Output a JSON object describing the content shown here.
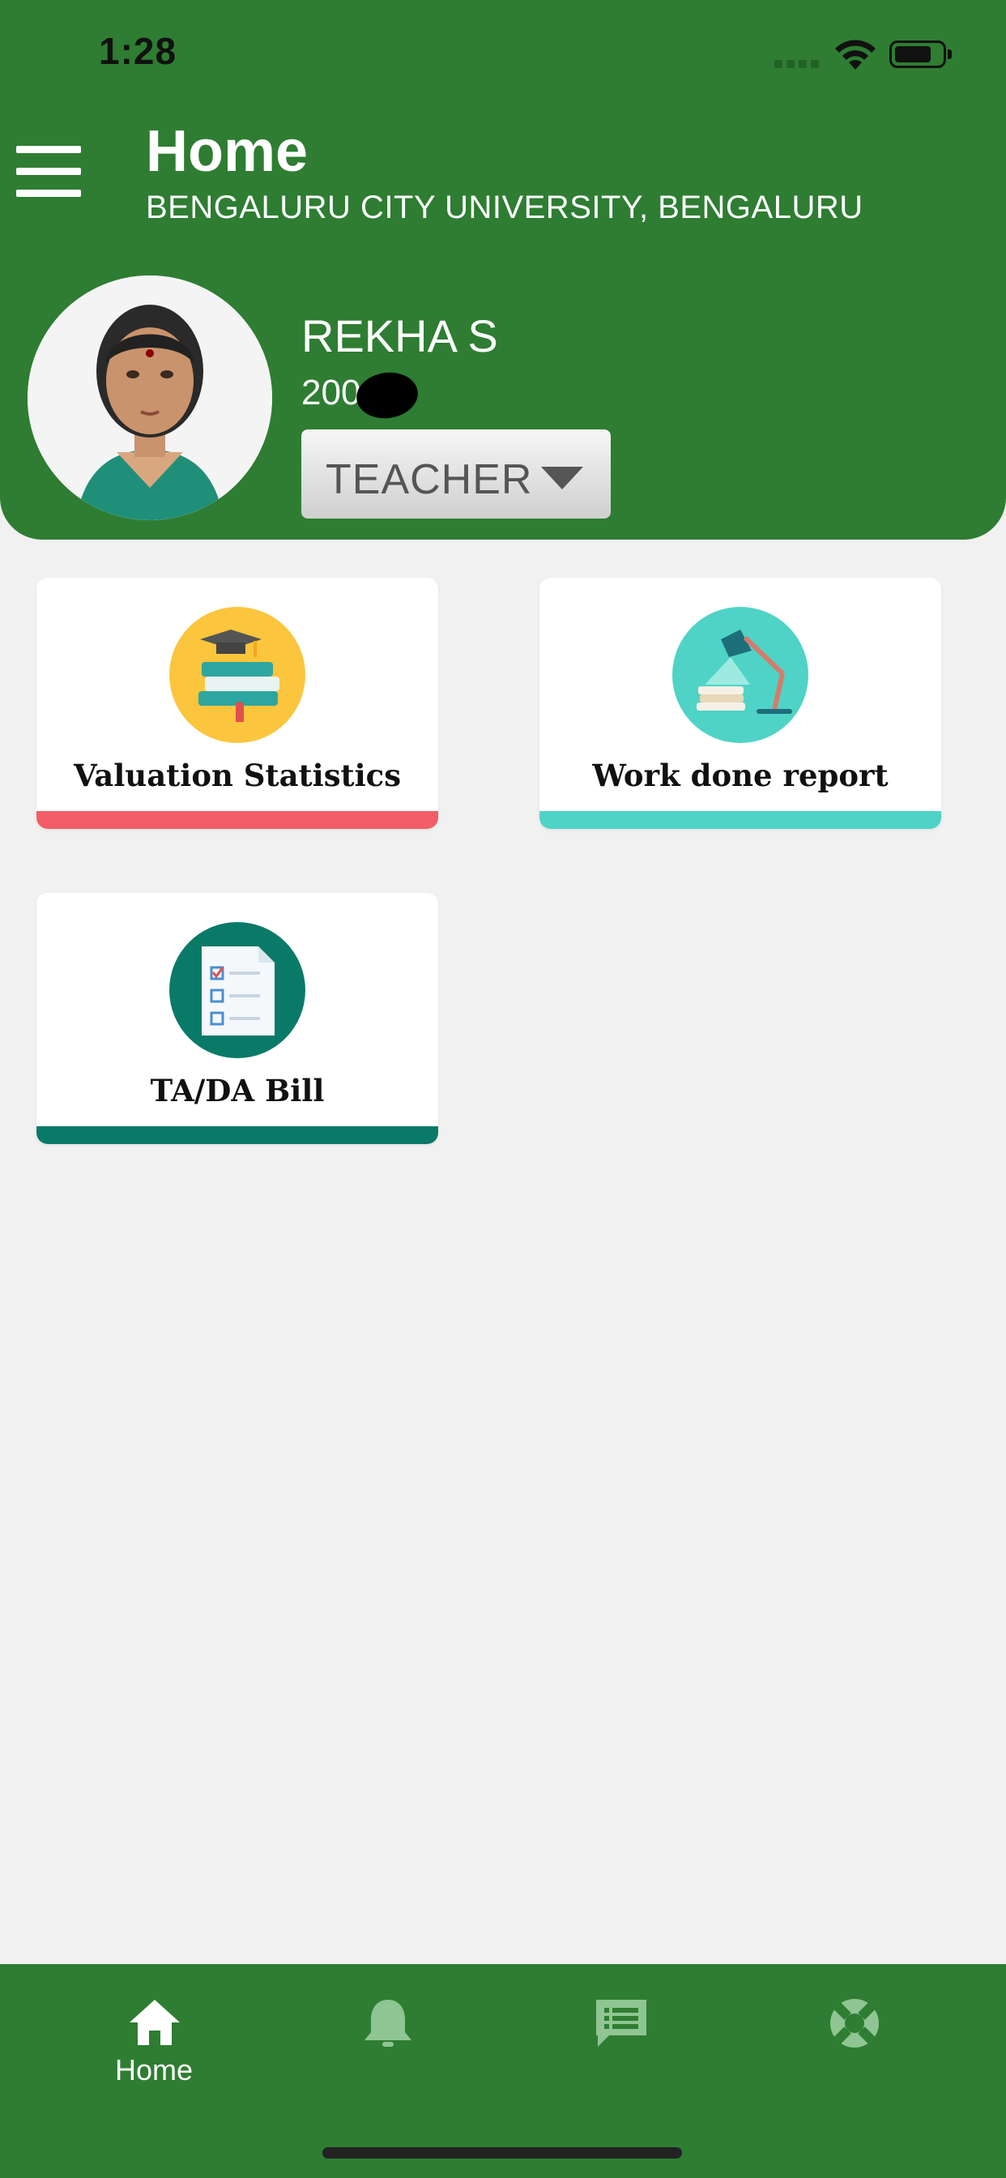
{
  "status_bar": {
    "time": "1:28"
  },
  "header": {
    "title": "Home",
    "subtitle": "BENGALURU CITY UNIVERSITY, BENGALURU"
  },
  "user": {
    "name": "REKHA S",
    "id_visible": "200",
    "role": "TEACHER"
  },
  "cards": [
    {
      "label": "Valuation Statistics",
      "accent": "#f25d67",
      "icon": "graduation-books-icon"
    },
    {
      "label": "Work done report",
      "accent": "#4fd3c6",
      "icon": "desk-lamp-icon"
    },
    {
      "label": "TA/DA Bill",
      "accent": "#0a7a68",
      "icon": "checklist-document-icon"
    }
  ],
  "bottom_nav": [
    {
      "label": "Home",
      "icon": "home-icon",
      "active": true
    },
    {
      "label": "",
      "icon": "bell-icon",
      "active": false
    },
    {
      "label": "",
      "icon": "message-icon",
      "active": false
    },
    {
      "label": "",
      "icon": "lifebuoy-icon",
      "active": false
    }
  ],
  "colors": {
    "primary": "#2e7d32",
    "background": "#f1f1f1",
    "inactive_icon": "#8fc592"
  }
}
